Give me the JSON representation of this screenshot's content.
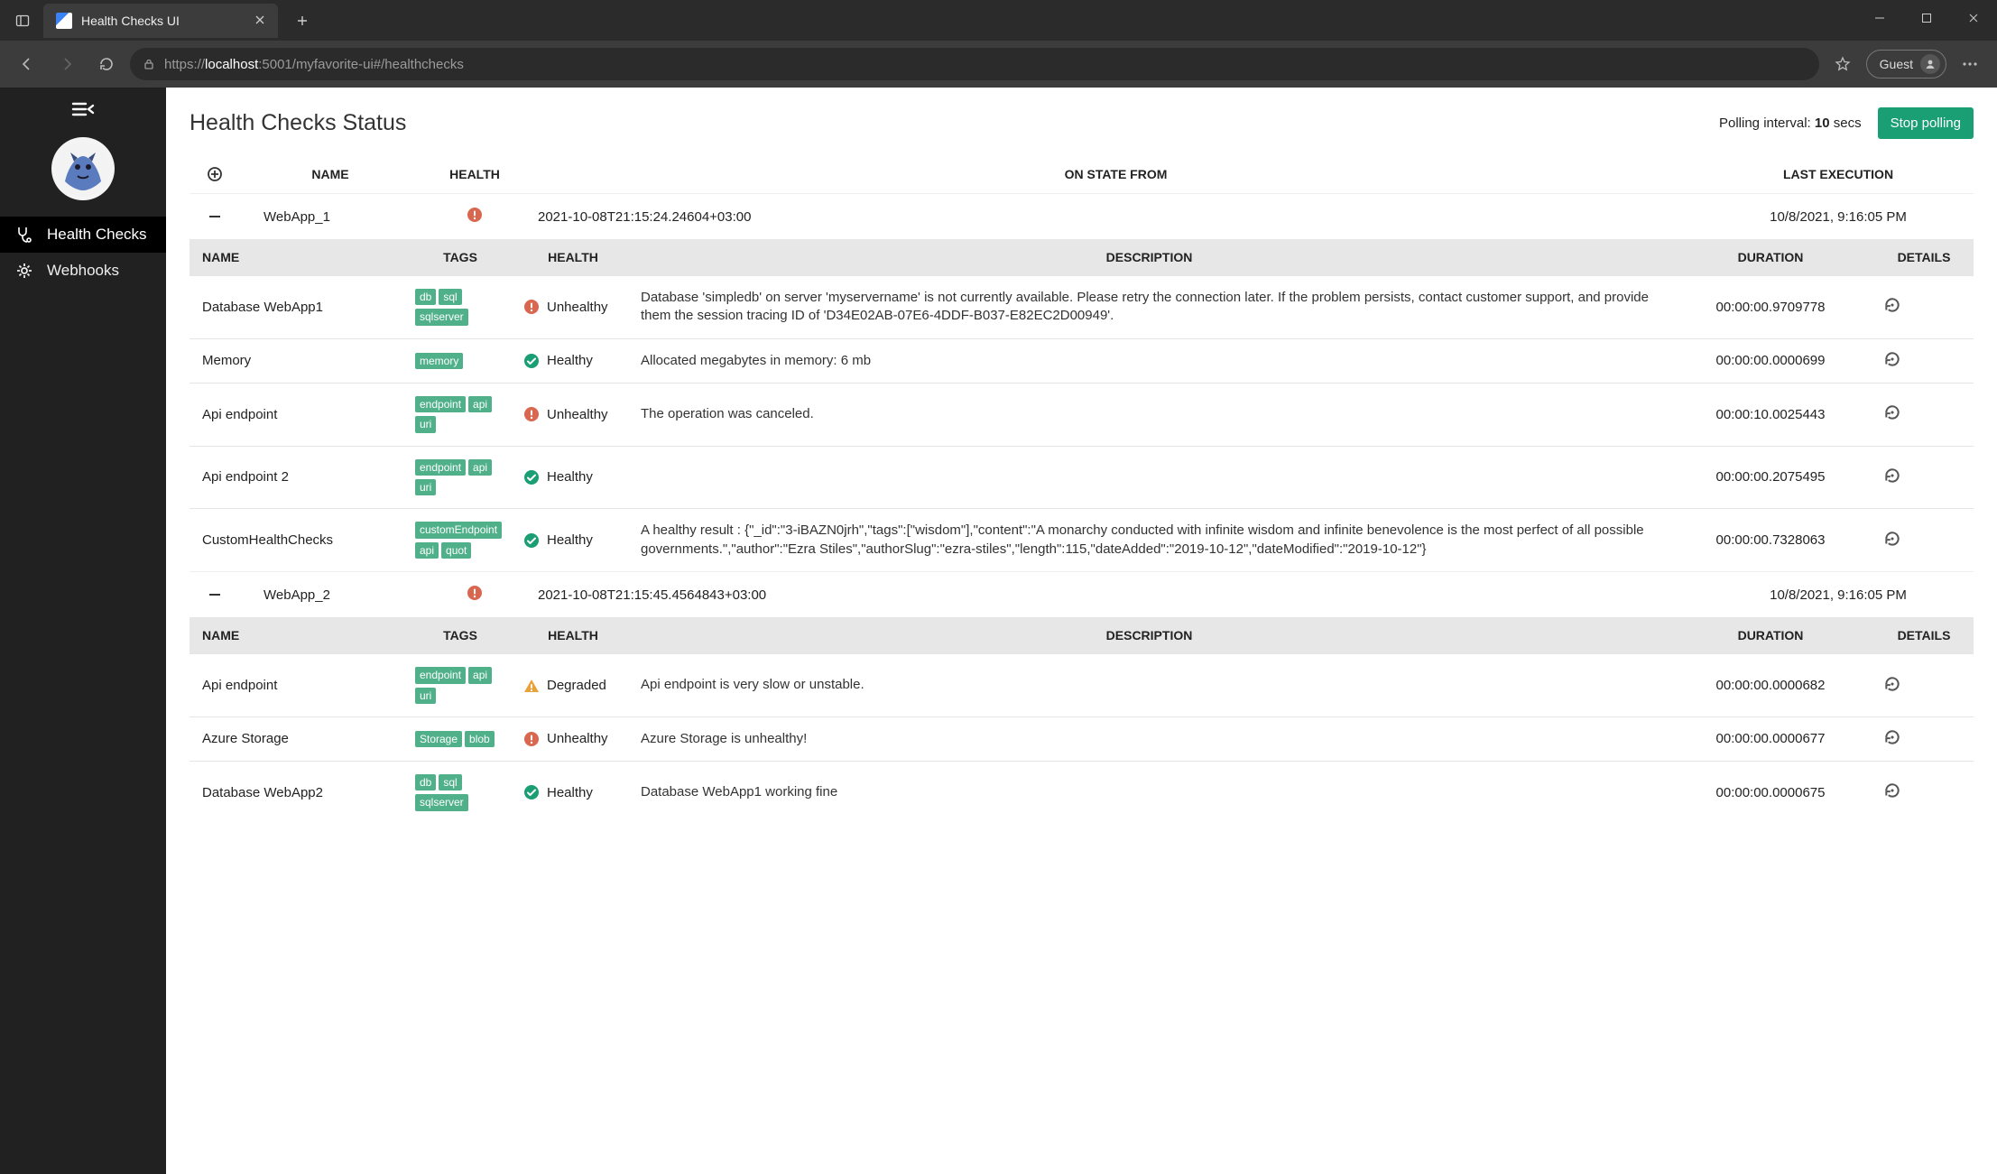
{
  "browser": {
    "tab_title": "Health Checks UI",
    "url_scheme": "https://",
    "url_host": "localhost",
    "url_port_path": ":5001/myfavorite-ui#/healthchecks",
    "guest_label": "Guest"
  },
  "sidebar": {
    "items": [
      {
        "label": "Health Checks",
        "icon": "stethoscope",
        "active": true
      },
      {
        "label": "Webhooks",
        "icon": "gear",
        "active": false
      }
    ]
  },
  "page": {
    "title": "Health Checks Status",
    "polling_label": "Polling interval:",
    "polling_value": "10",
    "polling_unit": "secs",
    "stop_label": "Stop polling"
  },
  "outer_columns": {
    "name": "NAME",
    "health": "HEALTH",
    "state": "ON STATE FROM",
    "last": "LAST EXECUTION"
  },
  "check_columns": {
    "name": "NAME",
    "tags": "TAGS",
    "health": "HEALTH",
    "desc": "DESCRIPTION",
    "dur": "DURATION",
    "det": "DETAILS"
  },
  "health_labels": {
    "Unhealthy": "Unhealthy",
    "Healthy": "Healthy",
    "Degraded": "Degraded"
  },
  "apps": [
    {
      "name": "WebApp_1",
      "health": "Unhealthy",
      "on_state_from": "2021-10-08T21:15:24.24604+03:00",
      "last_execution": "10/8/2021, 9:16:05 PM",
      "checks": [
        {
          "name": "Database WebApp1",
          "tags": [
            "db",
            "sql",
            "sqlserver"
          ],
          "health": "Unhealthy",
          "description": "Database 'simpledb' on server 'myservername' is not currently available. Please retry the connection later. If the problem persists, contact customer support, and provide them the session tracing ID of 'D34E02AB-07E6-4DDF-B037-E82EC2D00949'.",
          "duration": "00:00:00.9709778"
        },
        {
          "name": "Memory",
          "tags": [
            "memory"
          ],
          "health": "Healthy",
          "description": "Allocated megabytes in memory: 6 mb",
          "duration": "00:00:00.0000699"
        },
        {
          "name": "Api endpoint",
          "tags": [
            "endpoint",
            "api",
            "uri"
          ],
          "health": "Unhealthy",
          "description": "The operation was canceled.",
          "duration": "00:00:10.0025443"
        },
        {
          "name": "Api endpoint 2",
          "tags": [
            "endpoint",
            "api",
            "uri"
          ],
          "health": "Healthy",
          "description": "",
          "duration": "00:00:00.2075495"
        },
        {
          "name": "CustomHealthChecks",
          "tags": [
            "customEndpoint",
            "api",
            "quot"
          ],
          "health": "Healthy",
          "description": "A healthy result : {\"_id\":\"3-iBAZN0jrh\",\"tags\":[\"wisdom\"],\"content\":\"A monarchy conducted with infinite wisdom and infinite benevolence is the most perfect of all possible governments.\",\"author\":\"Ezra Stiles\",\"authorSlug\":\"ezra-stiles\",\"length\":115,\"dateAdded\":\"2019-10-12\",\"dateModified\":\"2019-10-12\"}",
          "duration": "00:00:00.7328063"
        }
      ]
    },
    {
      "name": "WebApp_2",
      "health": "Unhealthy",
      "on_state_from": "2021-10-08T21:15:45.4564843+03:00",
      "last_execution": "10/8/2021, 9:16:05 PM",
      "checks": [
        {
          "name": "Api endpoint",
          "tags": [
            "endpoint",
            "api",
            "uri"
          ],
          "health": "Degraded",
          "description": "Api endpoint is very slow or unstable.",
          "duration": "00:00:00.0000682"
        },
        {
          "name": "Azure Storage",
          "tags": [
            "Storage",
            "blob"
          ],
          "health": "Unhealthy",
          "description": "Azure Storage is unhealthy!",
          "duration": "00:00:00.0000677"
        },
        {
          "name": "Database WebApp2",
          "tags": [
            "db",
            "sql",
            "sqlserver"
          ],
          "health": "Healthy",
          "description": "Database WebApp1 working fine",
          "duration": "00:00:00.0000675"
        }
      ]
    }
  ]
}
